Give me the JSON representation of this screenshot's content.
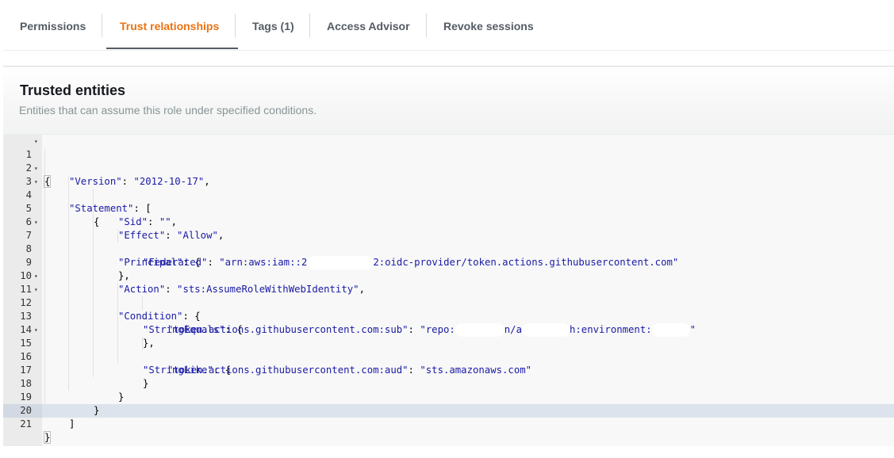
{
  "tabs": [
    {
      "label": "Permissions"
    },
    {
      "label": "Trust relationships"
    },
    {
      "label": "Tags (1)"
    },
    {
      "label": "Access Advisor"
    },
    {
      "label": "Revoke sessions"
    }
  ],
  "active_tab": "Trust relationships",
  "trusted_entities": {
    "title": "Trusted entities",
    "description": "Entities that can assume this role under specified conditions."
  },
  "editor": {
    "line_numbers": [
      "1",
      "2",
      "3",
      "4",
      "5",
      "6",
      "7",
      "8",
      "9",
      "10",
      "11",
      "12",
      "13",
      "14",
      "15",
      "16",
      "17",
      "18",
      "19",
      "20",
      "21"
    ],
    "lines": {
      "l1": "{",
      "l2_key": "\"Version\"",
      "l2_val": "\"2012-10-17\"",
      "l3_key": "\"Statement\"",
      "l4": "{",
      "l5_key": "\"Sid\"",
      "l5_val": "\"\"",
      "l6_key": "\"Effect\"",
      "l6_val": "\"Allow\"",
      "l7_key": "\"Principal\"",
      "l8_key": "\"Federated\"",
      "l8_val_a": "\"arn:aws:iam::2",
      "l8_val_b": "2:oidc-provider/token.actions.githubusercontent.com\"",
      "l9": "},",
      "l10_key": "\"Action\"",
      "l10_val": "\"sts:AssumeRoleWithWebIdentity\"",
      "l11_key": "\"Condition\"",
      "l12_key": "\"StringEquals\"",
      "l13_key": "\"token.actions.githubusercontent.com:sub\"",
      "l13_val_a": "\"repo:",
      "l13_val_b": "n/a",
      "l13_val_c": "h:environment:",
      "l13_val_d": "\"",
      "l14": "},",
      "l15_key": "\"StringLike\"",
      "l16_key": "\"token.actions.githubusercontent.com:aud\"",
      "l16_val": "\"sts.amazonaws.com\"",
      "l17": "}",
      "l18": "}",
      "l19": "}",
      "l20": "]",
      "l21": "}"
    }
  },
  "colors": {
    "active_tab": "#ec7211",
    "tab_text": "#545b64",
    "description": "#879596",
    "json_string": "#1a1aa6"
  }
}
